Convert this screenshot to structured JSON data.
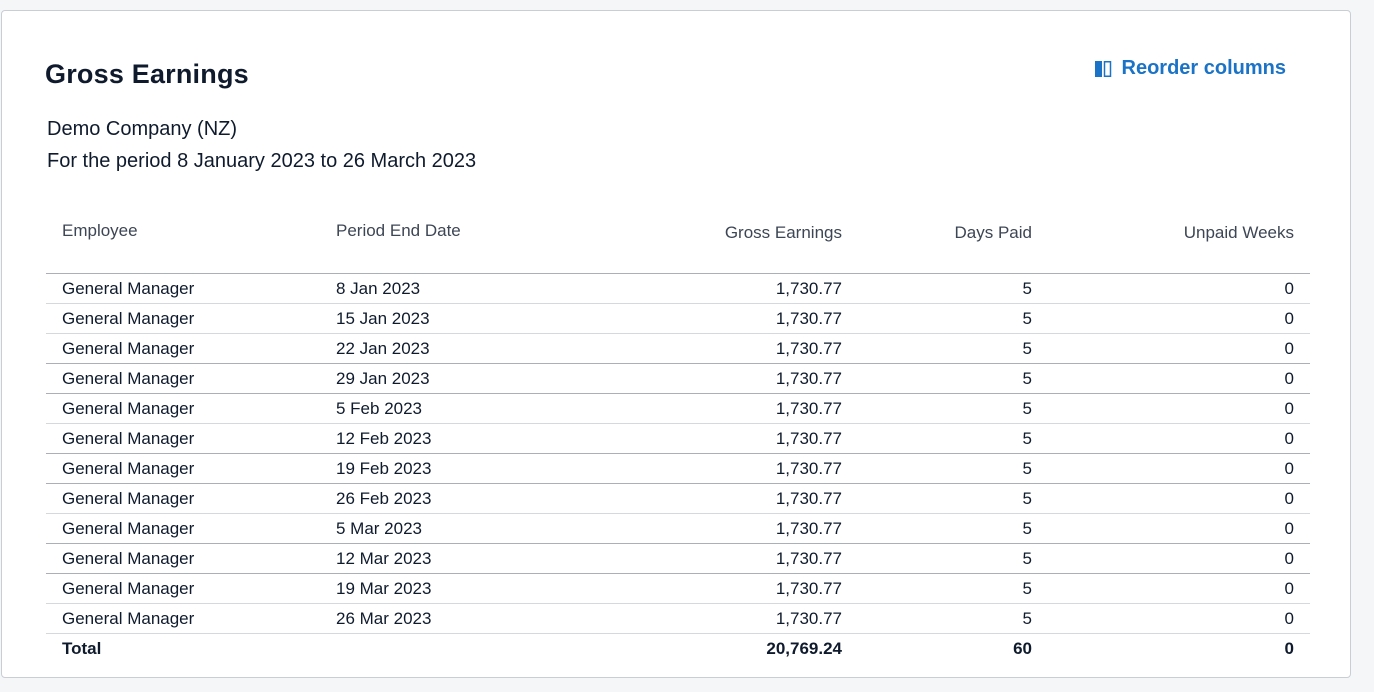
{
  "report": {
    "title": "Gross Earnings",
    "reorder_label": "Reorder columns",
    "company": "Demo Company (NZ)",
    "period": "For the period 8 January 2023 to 26 March 2023"
  },
  "colors": {
    "accent": "#1a73c6",
    "text": "#0f1b2d",
    "header_text": "#3d4654"
  },
  "table": {
    "columns": [
      "Employee",
      "Period End Date",
      "Gross Earnings",
      "Days Paid",
      "Unpaid Weeks"
    ],
    "rows": [
      {
        "employee": "General Manager",
        "date": "8 Jan 2023",
        "gross": "1,730.77",
        "days": "5",
        "unpaid": "0"
      },
      {
        "employee": "General Manager",
        "date": "15 Jan 2023",
        "gross": "1,730.77",
        "days": "5",
        "unpaid": "0"
      },
      {
        "employee": "General Manager",
        "date": "22 Jan 2023",
        "gross": "1,730.77",
        "days": "5",
        "unpaid": "0"
      },
      {
        "employee": "General Manager",
        "date": "29 Jan 2023",
        "gross": "1,730.77",
        "days": "5",
        "unpaid": "0"
      },
      {
        "employee": "General Manager",
        "date": "5 Feb 2023",
        "gross": "1,730.77",
        "days": "5",
        "unpaid": "0"
      },
      {
        "employee": "General Manager",
        "date": "12 Feb 2023",
        "gross": "1,730.77",
        "days": "5",
        "unpaid": "0"
      },
      {
        "employee": "General Manager",
        "date": "19 Feb 2023",
        "gross": "1,730.77",
        "days": "5",
        "unpaid": "0"
      },
      {
        "employee": "General Manager",
        "date": "26 Feb 2023",
        "gross": "1,730.77",
        "days": "5",
        "unpaid": "0"
      },
      {
        "employee": "General Manager",
        "date": "5 Mar 2023",
        "gross": "1,730.77",
        "days": "5",
        "unpaid": "0"
      },
      {
        "employee": "General Manager",
        "date": "12 Mar 2023",
        "gross": "1,730.77",
        "days": "5",
        "unpaid": "0"
      },
      {
        "employee": "General Manager",
        "date": "19 Mar 2023",
        "gross": "1,730.77",
        "days": "5",
        "unpaid": "0"
      },
      {
        "employee": "General Manager",
        "date": "26 Mar 2023",
        "gross": "1,730.77",
        "days": "5",
        "unpaid": "0"
      }
    ],
    "total": {
      "label": "Total",
      "gross": "20,769.24",
      "days": "60",
      "unpaid": "0"
    }
  },
  "icons": {
    "reorder": "reorder-columns-icon"
  }
}
